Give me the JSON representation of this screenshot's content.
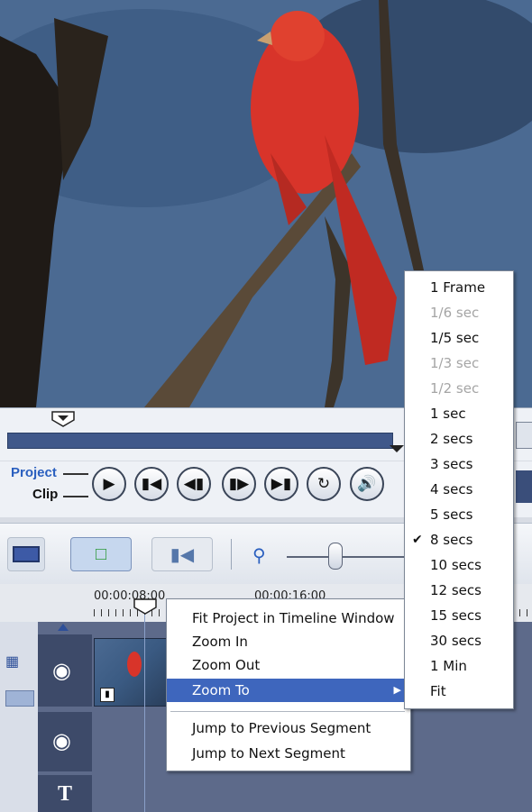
{
  "scrub": {
    "position_fraction": 0.115
  },
  "controls": {
    "project_label": "Project",
    "clip_label": "Clip"
  },
  "buttons": [
    {
      "name": "play-button",
      "icon": "play-icon"
    },
    {
      "name": "prev-button",
      "icon": "skip-start-icon"
    },
    {
      "name": "frame-back-button",
      "icon": "step-back-icon"
    },
    {
      "name": "frame-forward-button",
      "icon": "step-forward-icon"
    },
    {
      "name": "next-button",
      "icon": "skip-end-icon"
    },
    {
      "name": "repeat-button",
      "icon": "repeat-icon"
    },
    {
      "name": "volume-button",
      "icon": "speaker-icon"
    }
  ],
  "ruler": {
    "time_1": "00:00:08:00",
    "time_2": "00:00:16:00"
  },
  "context_menu": {
    "items": [
      "Fit Project in Timeline Window",
      "Zoom In",
      "Zoom Out",
      "Zoom To"
    ],
    "items2": [
      "Jump to Previous Segment",
      "Jump to Next Segment"
    ],
    "highlighted": "Zoom To"
  },
  "zoom_submenu": {
    "items": [
      {
        "label": "1 Frame",
        "enabled": true
      },
      {
        "label": "1/6 sec",
        "enabled": false
      },
      {
        "label": "1/5 sec",
        "enabled": true
      },
      {
        "label": "1/3 sec",
        "enabled": false
      },
      {
        "label": "1/2 sec",
        "enabled": false
      },
      {
        "label": "1 sec",
        "enabled": true
      },
      {
        "label": "2 secs",
        "enabled": true
      },
      {
        "label": "3 secs",
        "enabled": true
      },
      {
        "label": "4 secs",
        "enabled": true
      },
      {
        "label": "5 secs",
        "enabled": true
      },
      {
        "label": "8 secs",
        "enabled": true,
        "checked": true
      },
      {
        "label": "10 secs",
        "enabled": true
      },
      {
        "label": "12 secs",
        "enabled": true
      },
      {
        "label": "15 secs",
        "enabled": true
      },
      {
        "label": "30 secs",
        "enabled": true
      },
      {
        "label": "1 Min",
        "enabled": true
      },
      {
        "label": "Fit",
        "enabled": true
      }
    ]
  },
  "colors": {
    "accent": "#3e66bd",
    "scrub": "#40588a",
    "track": "#5d6a8a"
  }
}
